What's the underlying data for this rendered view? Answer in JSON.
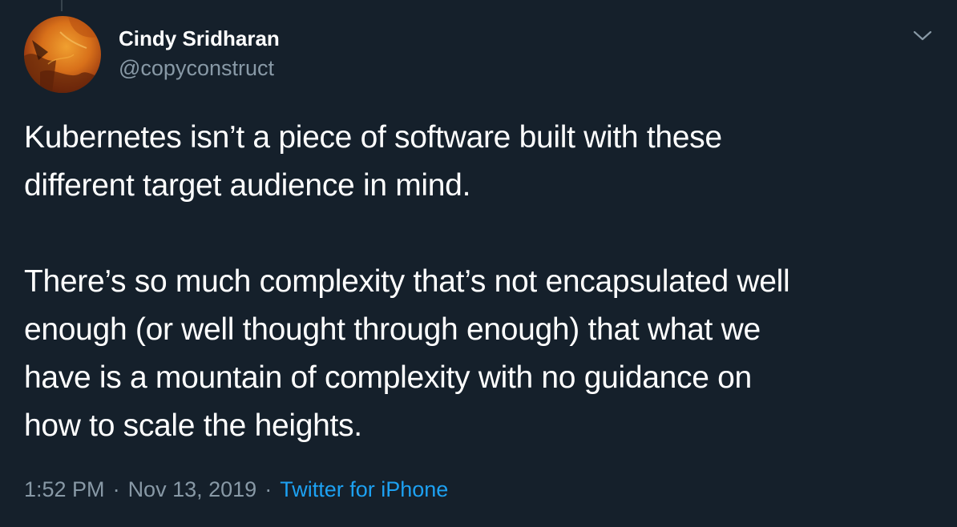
{
  "tweet": {
    "author": {
      "display_name": "Cindy Sridharan",
      "handle": "@copyconstruct"
    },
    "paragraphs": [
      "Kubernetes isn’t a piece of software built with these\ndifferent target audience in mind.",
      "There’s so much complexity that’s not encapsulated well\nenough (or well thought through enough) that what we\nhave is a mountain of complexity with no guidance on\nhow to scale the heights."
    ],
    "time": "1:52 PM",
    "separator": "·",
    "date": "Nov 13, 2019",
    "source": "Twitter for iPhone"
  },
  "icons": {
    "caret": "chevron-down-icon",
    "avatar": "avatar-image"
  },
  "colors": {
    "background": "#15202b",
    "text": "#ffffff",
    "secondary_text": "#8899a6",
    "link": "#1da1f2"
  }
}
